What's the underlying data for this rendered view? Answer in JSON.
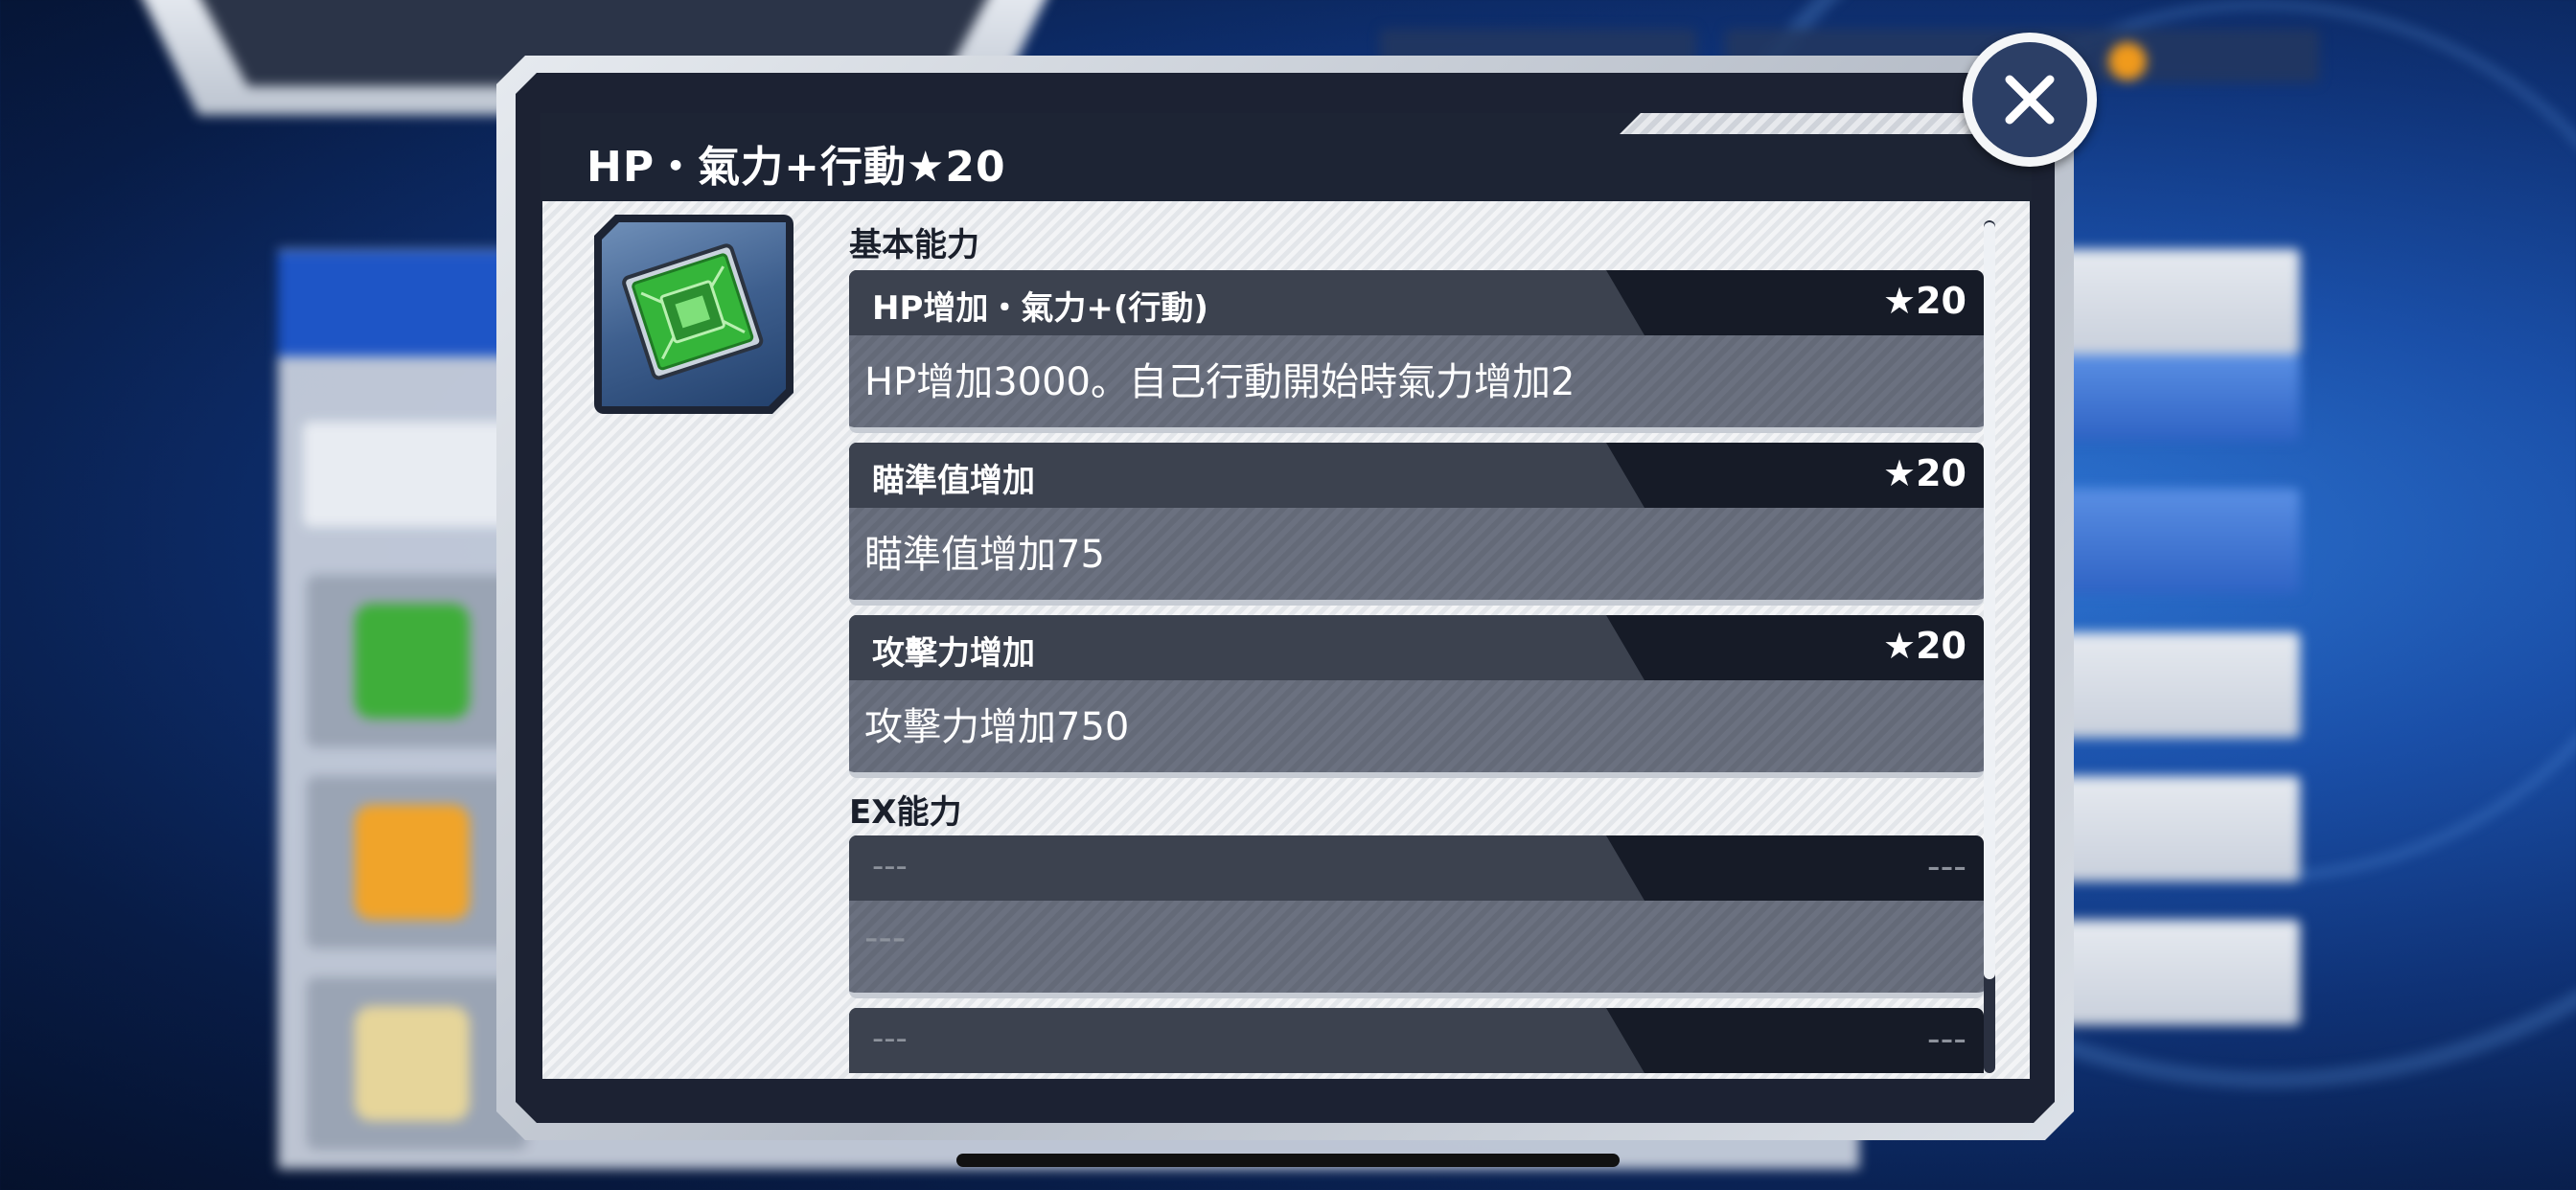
{
  "dialog": {
    "title": "HP・氣力+行動★20",
    "close_icon": "close-x-icon",
    "item_icon": "green-chip-icon"
  },
  "sections": {
    "basic_label": "基本能力",
    "ex_label": "EX能力"
  },
  "basic_abilities": [
    {
      "name": "HP增加・氣力+(行動)",
      "rank": "★20",
      "desc": "HP增加3000。自己行動開始時氣力增加2"
    },
    {
      "name": "瞄準值增加",
      "rank": "★20",
      "desc": "瞄準值增加75"
    },
    {
      "name": "攻擊力增加",
      "rank": "★20",
      "desc": "攻擊力增加750"
    }
  ],
  "ex_abilities": [
    {
      "name": "---",
      "rank": "---",
      "desc": "---"
    },
    {
      "name": "---",
      "rank": "---"
    }
  ],
  "colors": {
    "dialog_dark": "#1d2434",
    "ability_desc_bg": "#6b7180",
    "close_button": "#2c3f66",
    "chip_green": "#35b53a"
  }
}
